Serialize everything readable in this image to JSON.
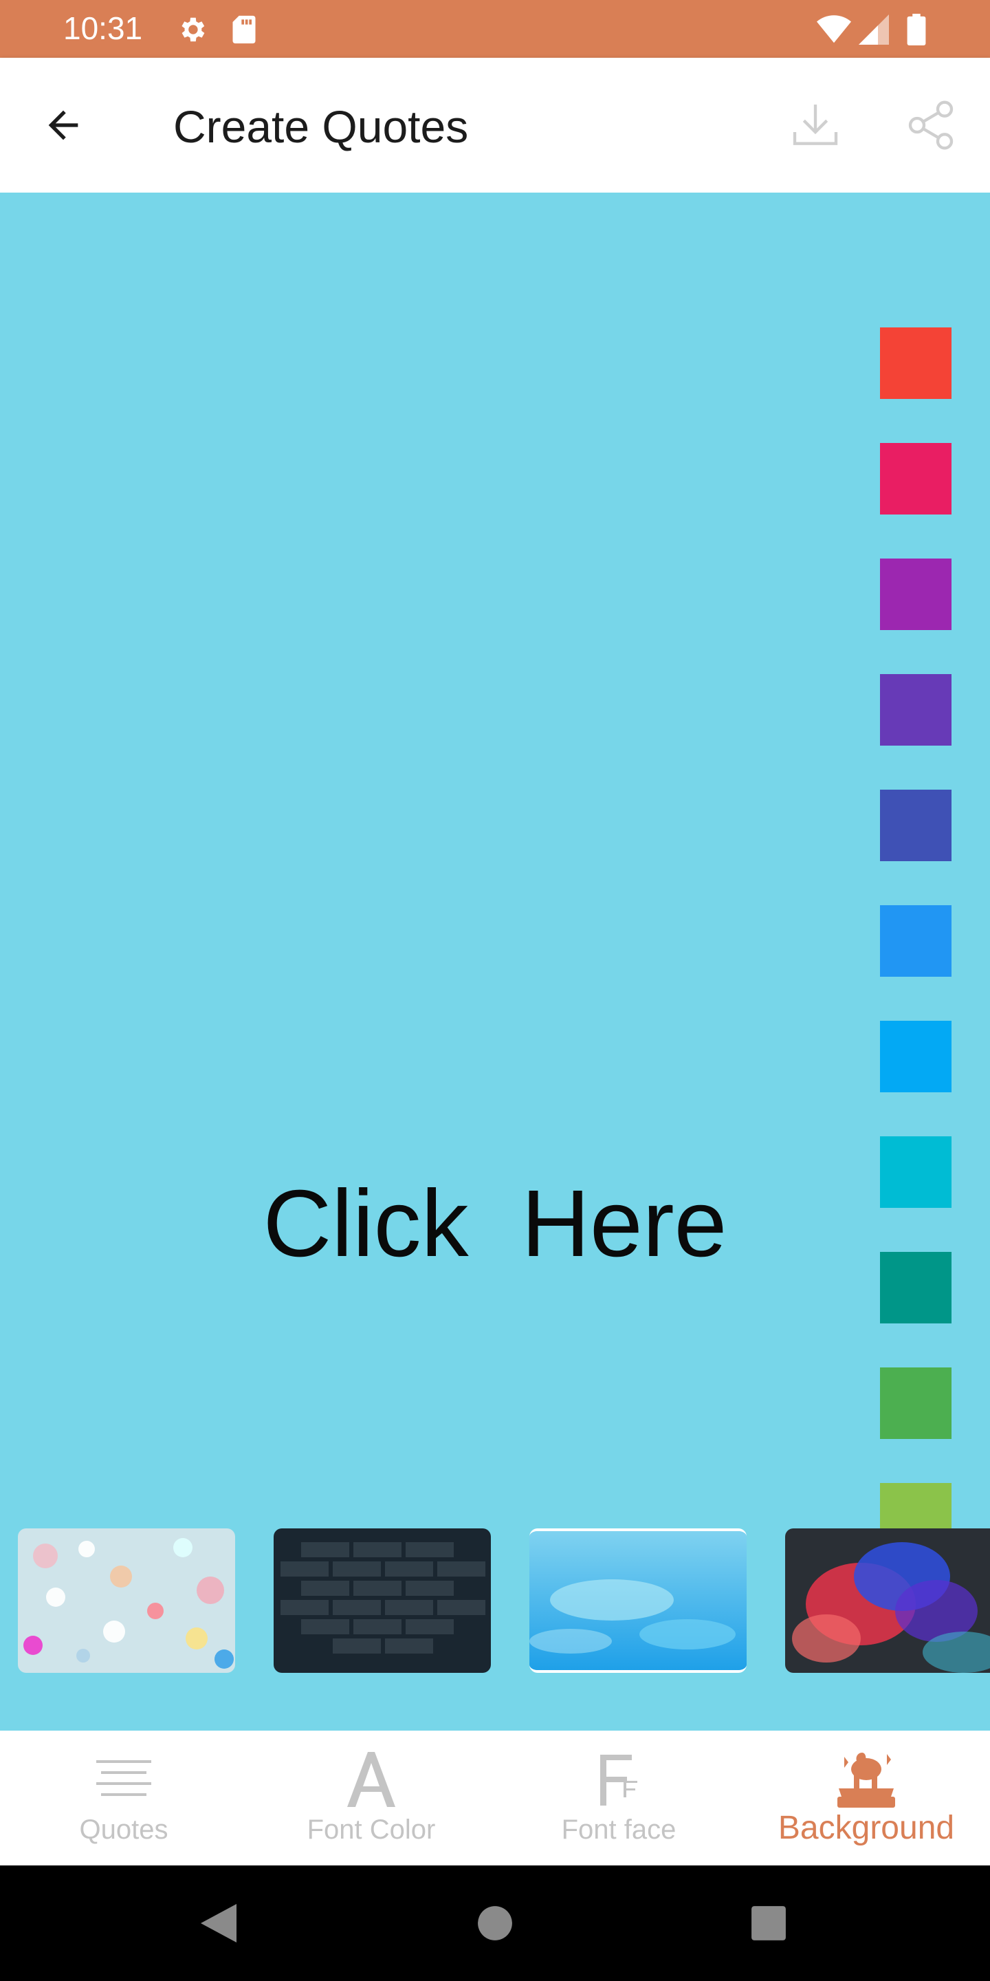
{
  "status_bar": {
    "time": "10:31",
    "left_icons": [
      "gear-icon",
      "sd-card-icon"
    ],
    "right_icons": [
      "wifi-icon",
      "signal-icon",
      "battery-icon"
    ],
    "color": "#d97f55"
  },
  "app_bar": {
    "title": "Create Quotes",
    "back_icon": "arrow-left-icon",
    "actions": [
      "download-icon",
      "share-icon"
    ]
  },
  "canvas": {
    "text": "Click  Here",
    "background_color": "#77d6e9"
  },
  "color_swatches": [
    "#f44336",
    "#e91e63",
    "#9c27b0",
    "#673ab7",
    "#3f51b5",
    "#2196f3",
    "#03a9f4",
    "#00bcd4",
    "#009688",
    "#4caf50",
    "#8bc34a"
  ],
  "background_images": [
    {
      "name": "bokeh-lights"
    },
    {
      "name": "dark-brick-wall"
    },
    {
      "name": "blue-water"
    },
    {
      "name": "colored-smoke"
    }
  ],
  "bottom_nav": {
    "items": [
      {
        "label": "Quotes",
        "icon": "text-lines-icon",
        "active": false
      },
      {
        "label": "Font Color",
        "icon": "font-a-icon",
        "active": false
      },
      {
        "label": "Font face",
        "icon": "font-face-icon",
        "active": false
      },
      {
        "label": "Background",
        "icon": "background-icon",
        "active": true
      }
    ],
    "active_color": "#d97f55",
    "inactive_color": "#c4c4c4"
  },
  "system_nav": [
    "back-triangle-icon",
    "home-circle-icon",
    "recents-square-icon"
  ]
}
